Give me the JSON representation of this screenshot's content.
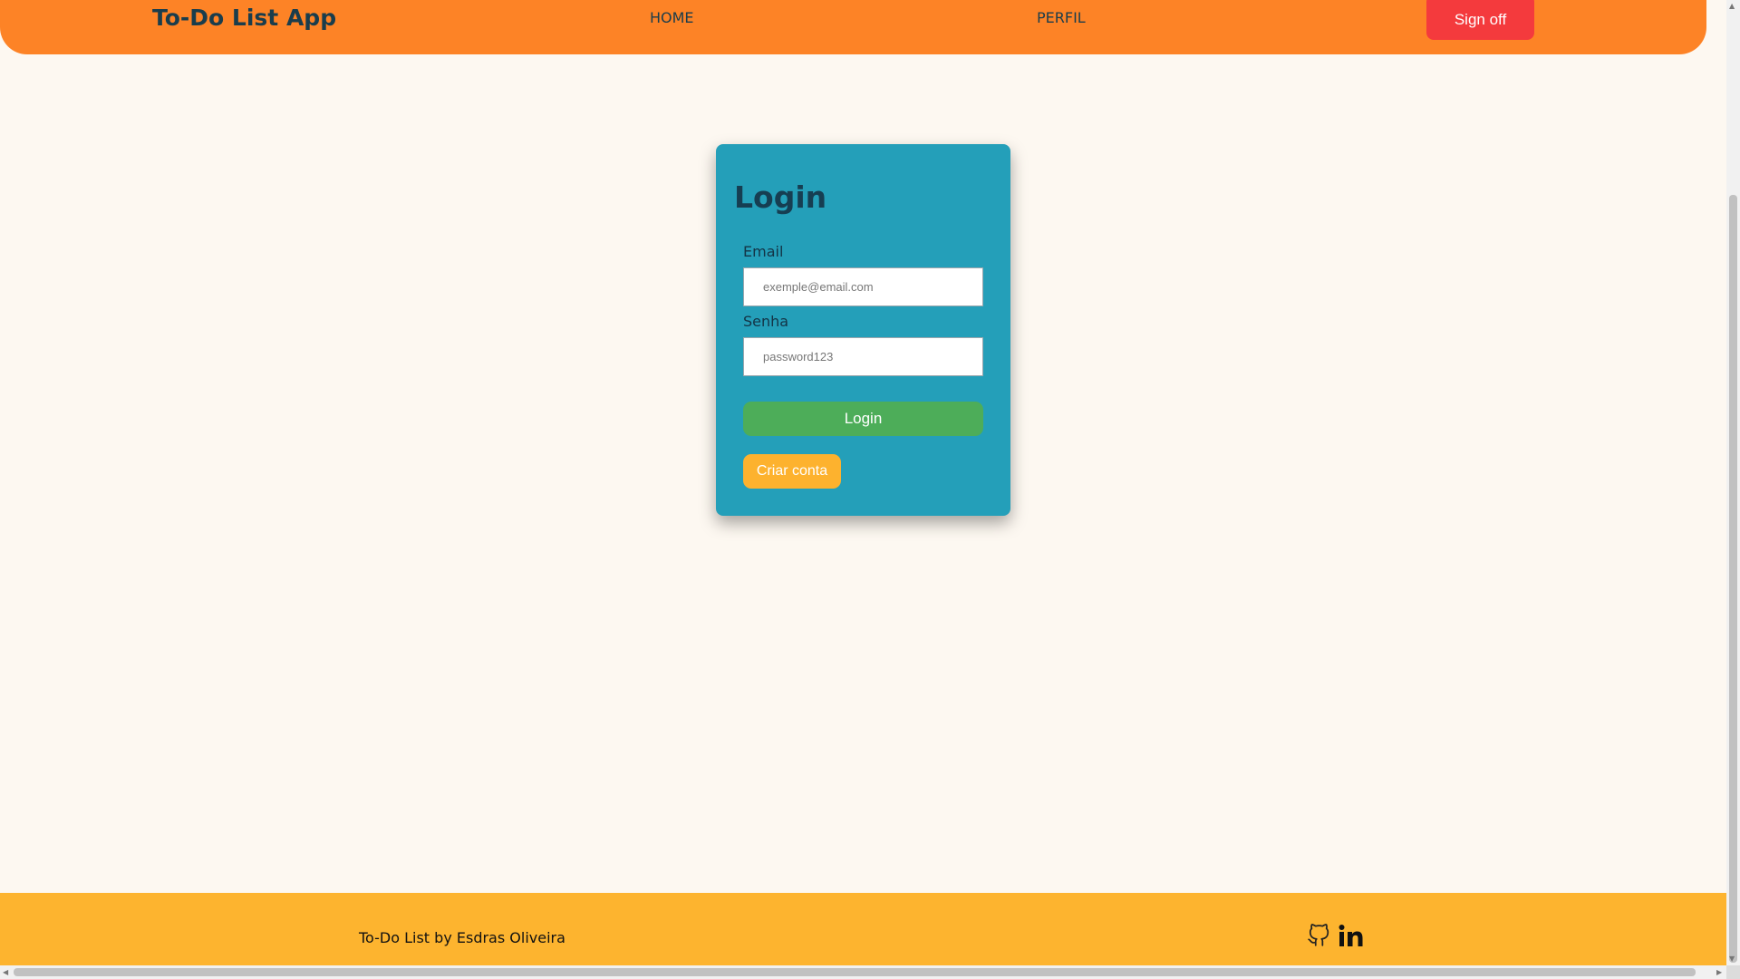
{
  "header": {
    "brand": "To-Do List App",
    "nav": {
      "home": "HOME",
      "perfil": "PERFIL"
    },
    "signoff_label": "Sign off"
  },
  "login_card": {
    "title": "Login",
    "email": {
      "label": "Email",
      "placeholder": "exemple@email.com",
      "value": ""
    },
    "senha": {
      "label": "Senha",
      "placeholder": "password123",
      "value": ""
    },
    "login_button": "Login",
    "create_button": "Criar conta"
  },
  "footer": {
    "text": "To-Do List by Esdras Oliveira",
    "icons": [
      "github-icon",
      "linkedin-icon"
    ]
  },
  "colors": {
    "header_bg": "#fd8326",
    "page_bg": "#fdf8f1",
    "card_bg": "#249fb9",
    "signoff_btn": "#f43a3d",
    "login_btn": "#4dad59",
    "create_btn": "#fdb22e",
    "footer_bg": "#fdb42f"
  }
}
